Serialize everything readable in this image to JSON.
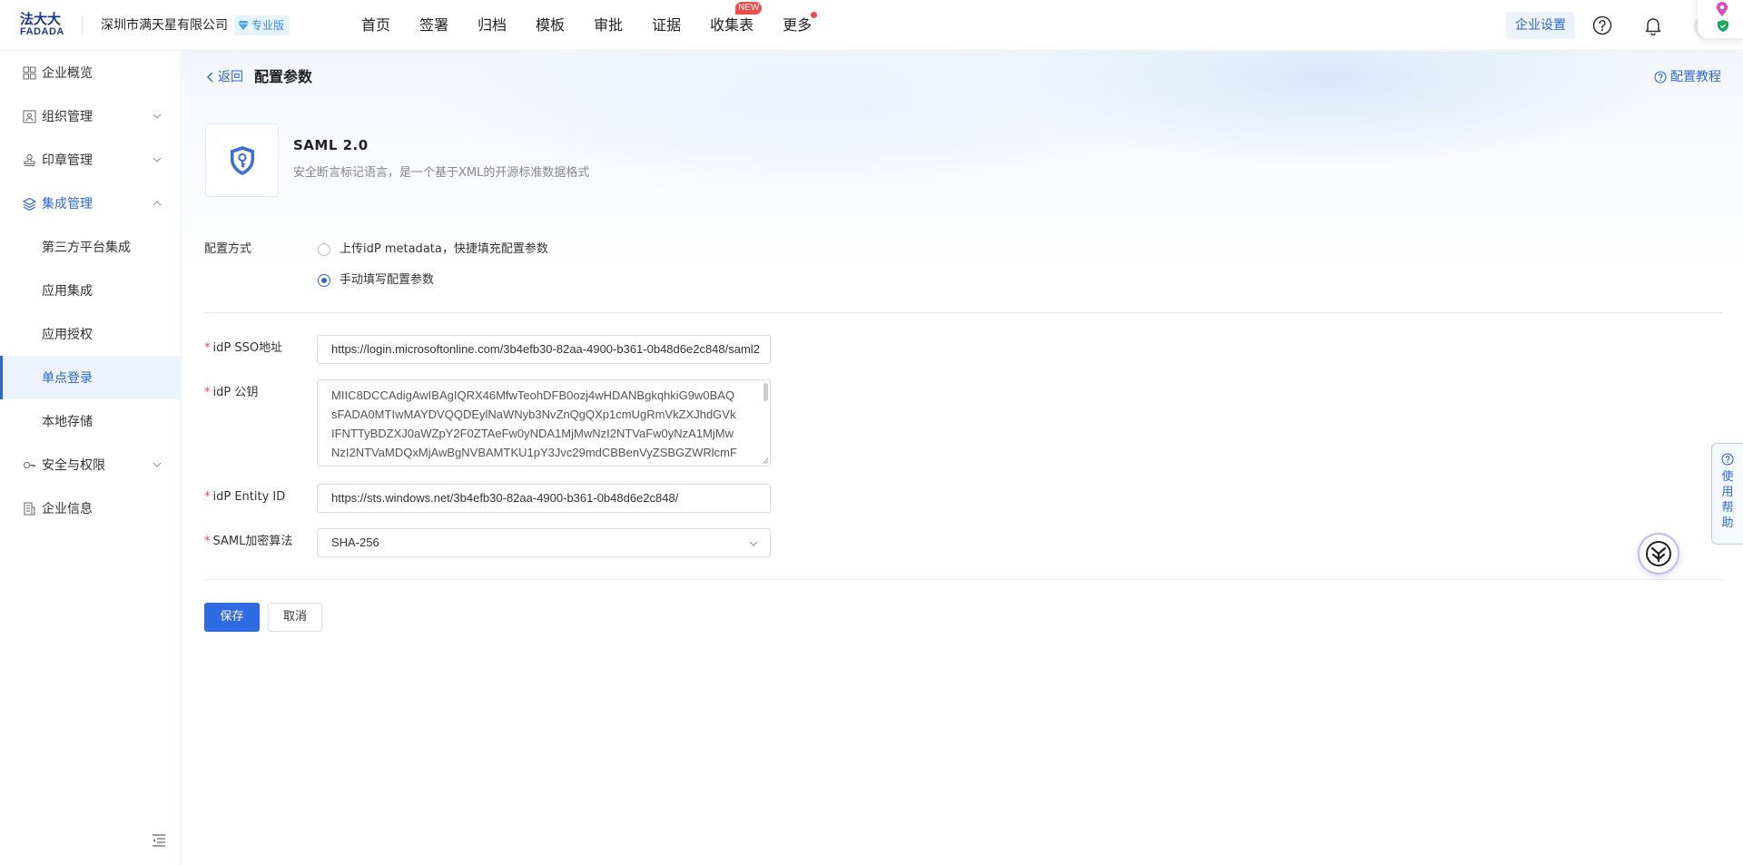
{
  "brand": {
    "logo_cn": "法大大",
    "logo_en": "FADADA"
  },
  "header": {
    "company": "深圳市满天星有限公司",
    "edition": "专业版",
    "nav": [
      {
        "label": "首页"
      },
      {
        "label": "签署"
      },
      {
        "label": "归档"
      },
      {
        "label": "模板"
      },
      {
        "label": "审批"
      },
      {
        "label": "证据"
      },
      {
        "label": "收集表",
        "badge": "NEW"
      },
      {
        "label": "更多"
      }
    ],
    "enterprise_settings": "企业设置"
  },
  "sidebar": {
    "items": [
      {
        "label": "企业概览"
      },
      {
        "label": "组织管理"
      },
      {
        "label": "印章管理"
      },
      {
        "label": "集成管理"
      },
      {
        "label": "第三方平台集成"
      },
      {
        "label": "应用集成"
      },
      {
        "label": "应用授权"
      },
      {
        "label": "单点登录"
      },
      {
        "label": "本地存储"
      },
      {
        "label": "安全与权限"
      },
      {
        "label": "企业信息"
      }
    ],
    "active": "单点登录"
  },
  "page": {
    "back": "返回",
    "title": "配置参数",
    "tutorial": "配置教程"
  },
  "app": {
    "name": "SAML 2.0",
    "description": "安全断言标记语言，是一个基于XML的开源标准数据格式"
  },
  "form": {
    "config_method": {
      "label": "配置方式",
      "options": [
        {
          "label": "上传idP metadata，快捷填充配置参数",
          "checked": false
        },
        {
          "label": "手动填写配置参数",
          "checked": true
        }
      ]
    },
    "sso_url": {
      "label": "idP SSO地址",
      "value": "https://login.microsoftonline.com/3b4efb30-82aa-4900-b361-0b48d6e2c848/saml2"
    },
    "public_key": {
      "label": "idP 公钥",
      "lines": [
        "MIIC8DCCAdigAwIBAgIQRX46MfwTeohDFB0ozj4wHDANBgkqhkiG9w0BAQ",
        "sFADA0MTIwMAYDVQQDEylNaWNyb3NvZnQgQXp1cmUgRmVkZXJhdGVk",
        "IFNTTyBDZXJ0aWZpY2F0ZTAeFw0yNDA1MjMwNzI2NTVaFw0yNzA1MjMw",
        "NzI2NTVaMDQxMjAwBgNVBAMTKU1pY3Jvc29mdCBBenVyZSBGZWRlcmF"
      ]
    },
    "entity_id": {
      "label": "idP Entity ID",
      "value": "https://sts.windows.net/3b4efb30-82aa-4900-b361-0b48d6e2c848/"
    },
    "algorithm": {
      "label": "SAML加密算法",
      "value": "SHA-256"
    },
    "required_mark": "*",
    "save": "保存",
    "cancel": "取消"
  },
  "help_tab": {
    "chars": [
      "使",
      "用",
      "帮",
      "助"
    ]
  },
  "colors": {
    "primary": "#2f66d1",
    "danger": "#e5484d",
    "badge": "#f04b4b"
  }
}
